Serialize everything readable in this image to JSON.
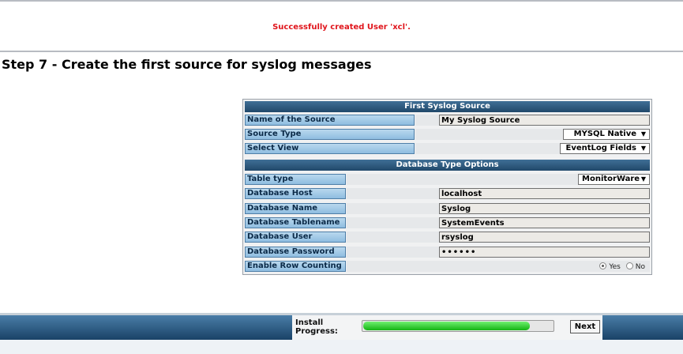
{
  "message": "Successfully created User 'xcl'.",
  "step_title": "Step 7 - Create the first source for syslog messages",
  "sections": {
    "first_source": "First Syslog Source",
    "db_options": "Database Type Options"
  },
  "fields": {
    "source_name": {
      "label": "Name of the Source",
      "value": "My Syslog Source"
    },
    "source_type": {
      "label": "Source Type",
      "value": "MYSQL Native"
    },
    "select_view": {
      "label": "Select View",
      "value": "EventLog Fields"
    },
    "table_type": {
      "label": "Table type",
      "value": "MonitorWare"
    },
    "db_host": {
      "label": "Database Host",
      "value": "localhost"
    },
    "db_name": {
      "label": "Database Name",
      "value": "Syslog"
    },
    "db_tablename": {
      "label": "Database Tablename",
      "value": "SystemEvents"
    },
    "db_user": {
      "label": "Database User",
      "value": "rsyslog"
    },
    "db_password": {
      "label": "Database Password",
      "value": "••••••"
    },
    "row_counting": {
      "label": "Enable Row Counting",
      "yes": "Yes",
      "no": "No",
      "selected": "Yes"
    }
  },
  "footer": {
    "progress_label_line1": "Install",
    "progress_label_line2": "Progress:",
    "progress_fraction": 0.88,
    "next_label": "Next"
  },
  "icons": {
    "dropdown": "chevron-down-icon",
    "radio": "radio-icon"
  },
  "colors": {
    "message": "#e0141b",
    "header": "#2c577c",
    "label": "#a9cde9",
    "progress": "#22c422"
  }
}
